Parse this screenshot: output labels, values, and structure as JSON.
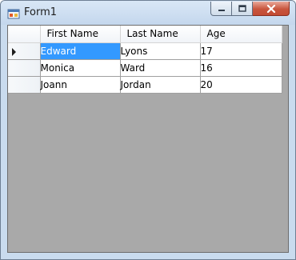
{
  "window": {
    "title": "Form1",
    "app_icon": "form-app-icon",
    "caption_buttons": [
      "minimize-icon",
      "maximize-icon",
      "close-icon"
    ]
  },
  "grid": {
    "columns": [
      "First Name",
      "Last Name",
      "Age"
    ],
    "current_row_indicator": "row-pointer-icon",
    "selected_cell": {
      "row": 0,
      "column": "First Name"
    },
    "rows": [
      {
        "first_name": "Edward",
        "last_name": "Lyons",
        "age": "17"
      },
      {
        "first_name": "Monica",
        "last_name": "Ward",
        "age": "16"
      },
      {
        "first_name": "Joann",
        "last_name": "Jordan",
        "age": "20"
      }
    ]
  },
  "colors": {
    "selection": "#3399ff",
    "grid_background": "#a9a9a9",
    "title_bar": "#c4d7ed",
    "close_button": "#c8553d"
  }
}
